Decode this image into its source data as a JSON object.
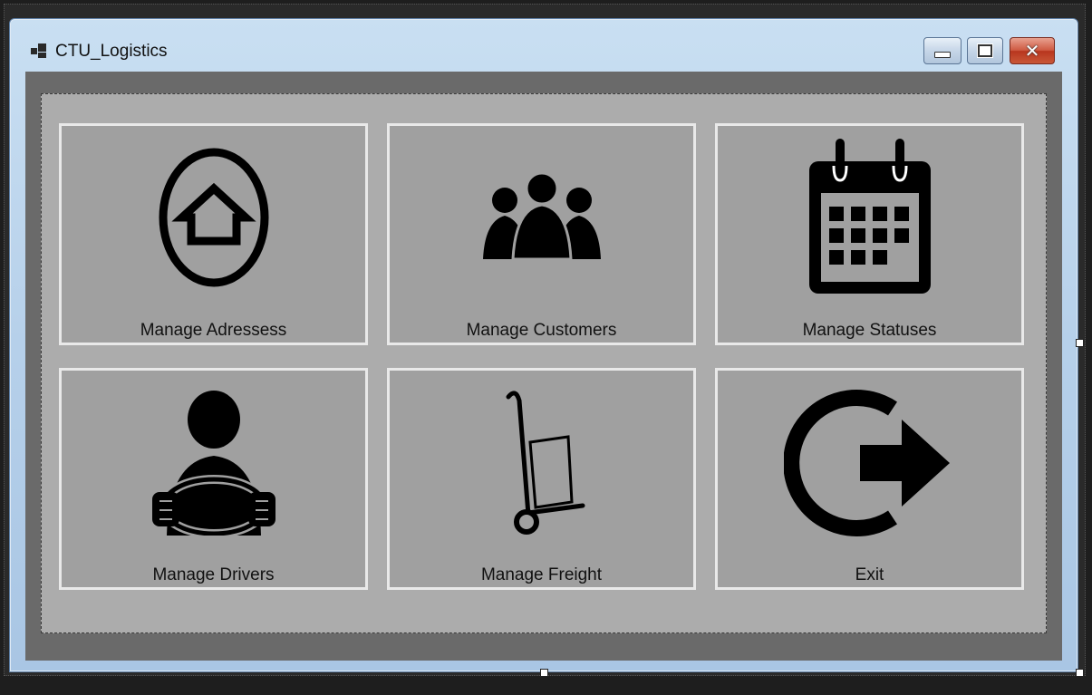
{
  "window": {
    "title": "CTU_Logistics",
    "controls": [
      "minimize",
      "maximize",
      "close"
    ],
    "close_glyph": "✕"
  },
  "tiles": [
    {
      "label": "Manage Adressess",
      "icon": "home-circle-icon"
    },
    {
      "label": "Manage Customers",
      "icon": "people-group-icon"
    },
    {
      "label": "Manage Statuses",
      "icon": "calendar-icon"
    },
    {
      "label": "Manage Drivers",
      "icon": "driver-steering-wheel-icon"
    },
    {
      "label": "Manage Freight",
      "icon": "hand-truck-icon"
    },
    {
      "label": "Exit",
      "icon": "exit-arrow-icon"
    }
  ],
  "colors": {
    "window_frame": "#b6d0ea",
    "client_bg": "#6a6a6a",
    "panel_bg": "#acacac",
    "tile_bg": "#a0a0a0",
    "tile_border": "#e9e9e9",
    "icon": "#000000"
  }
}
